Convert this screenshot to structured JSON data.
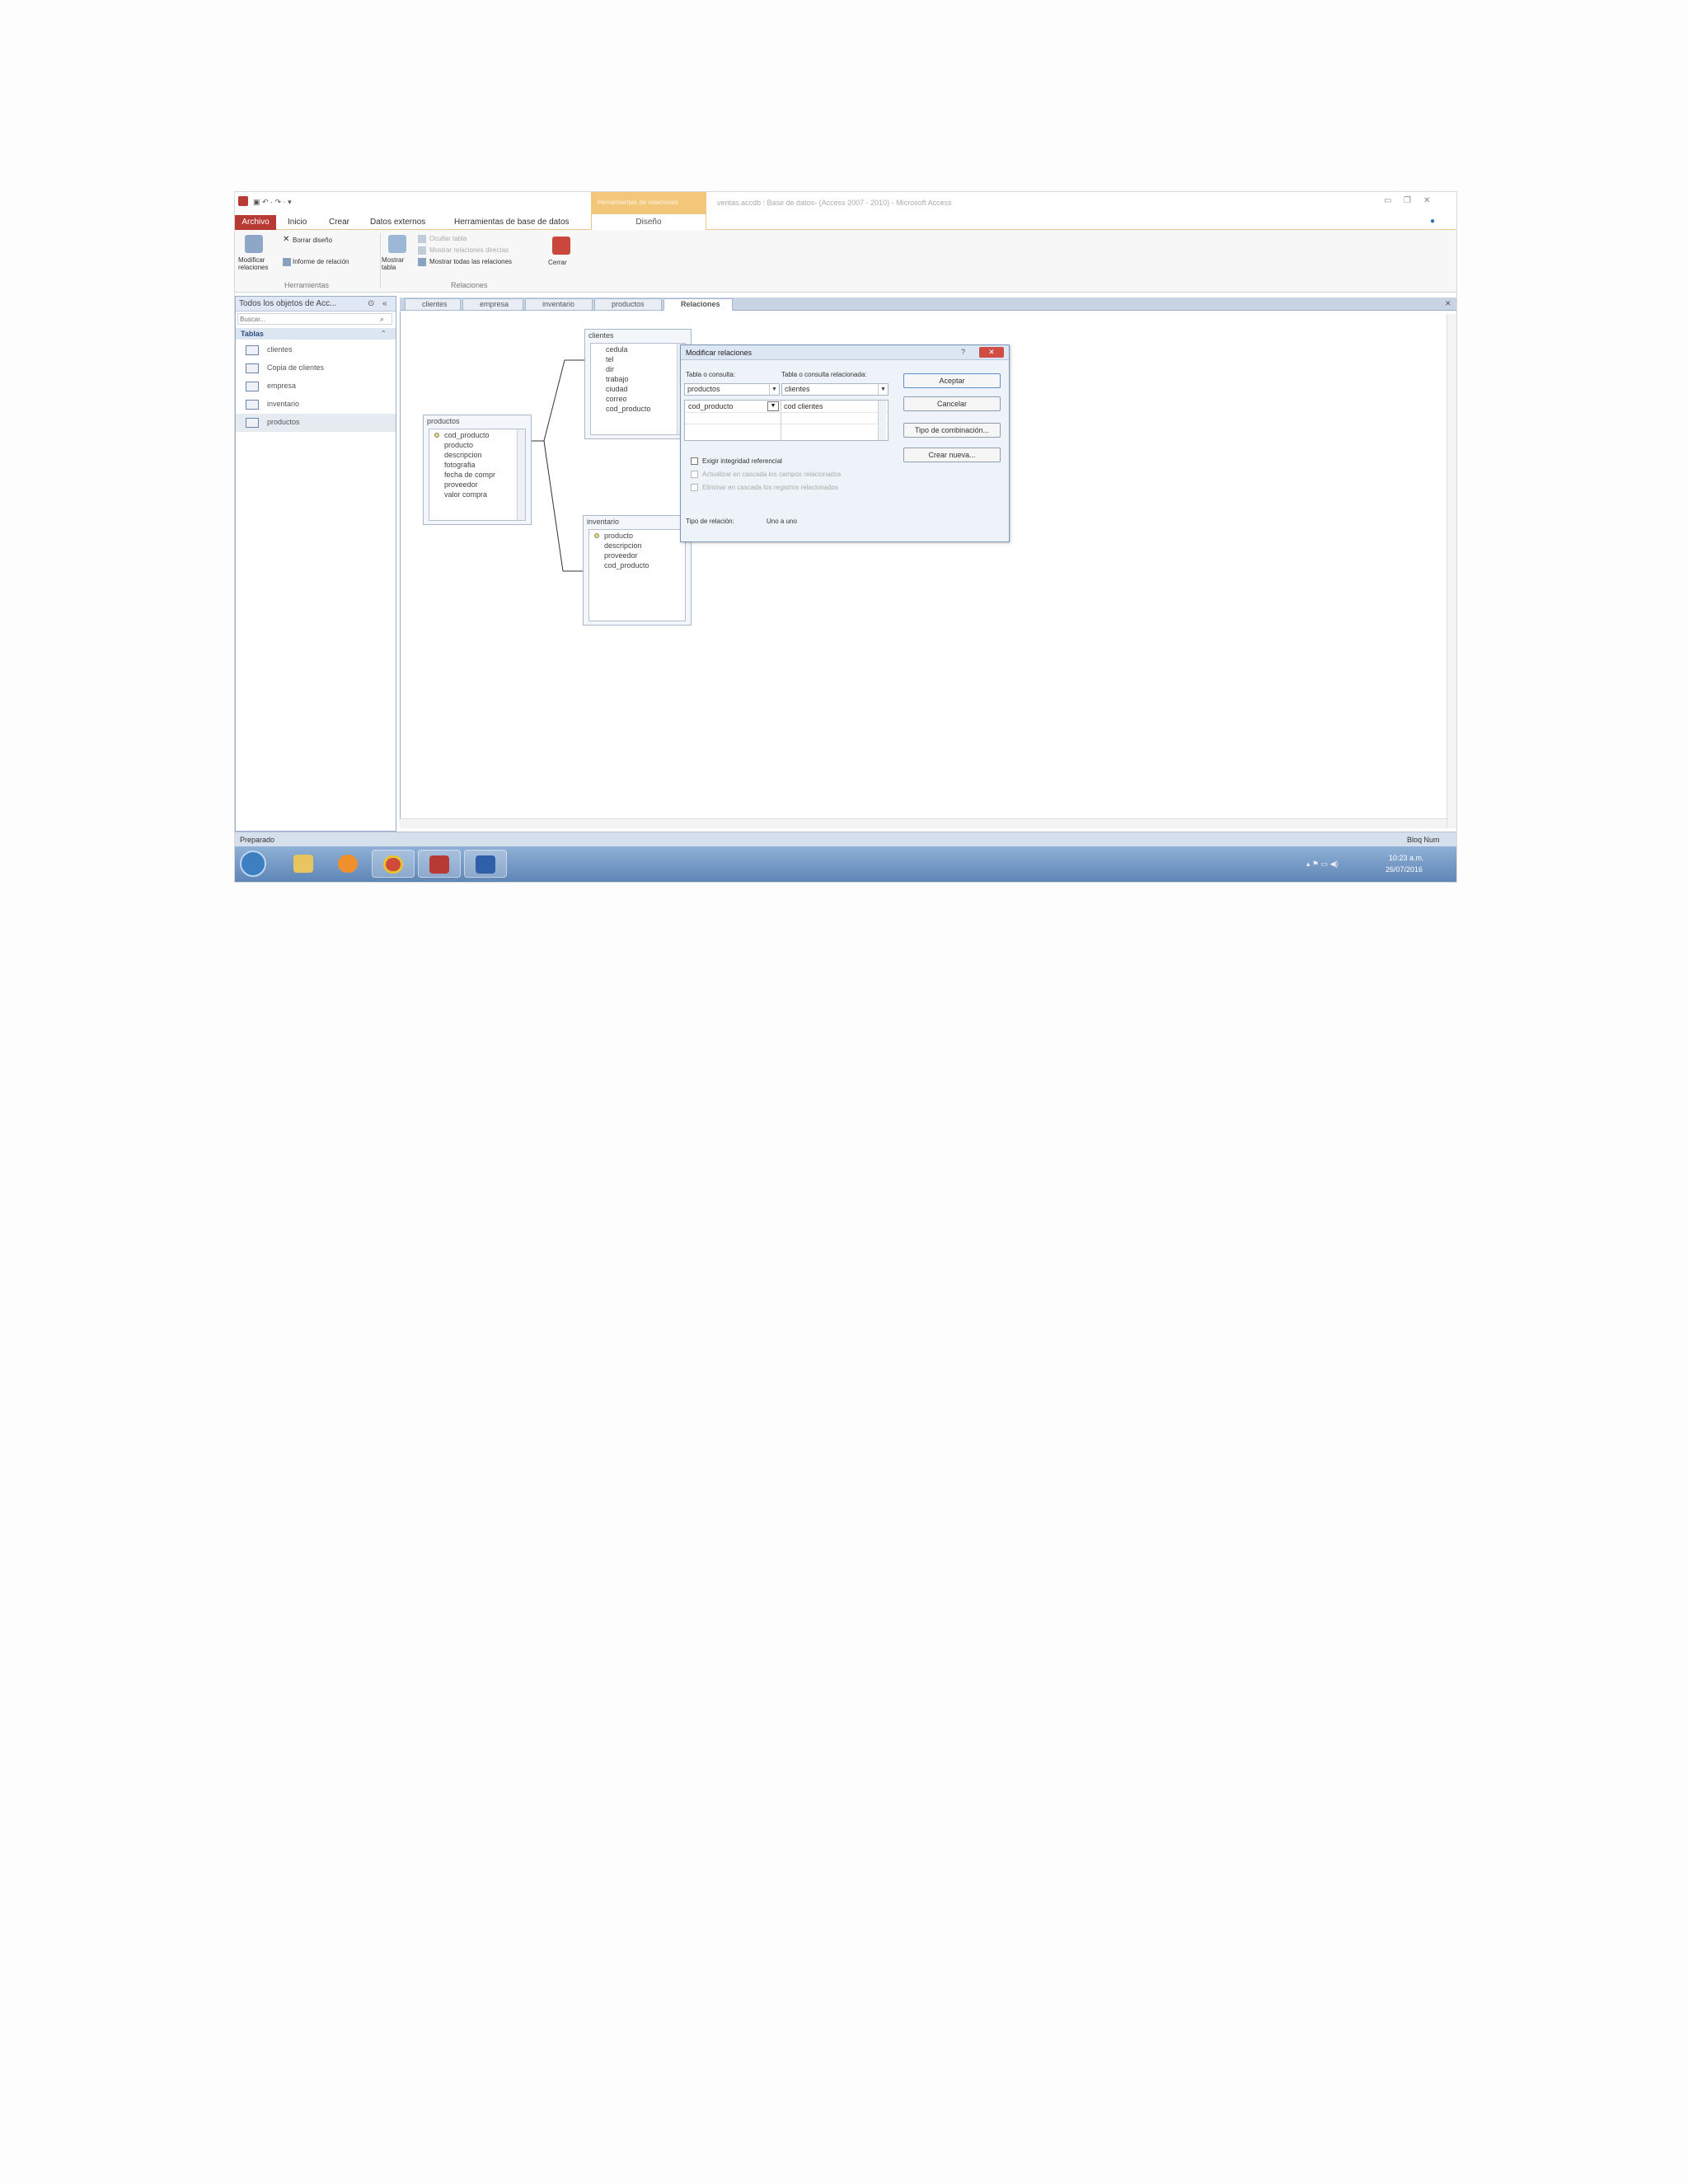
{
  "window": {
    "title": "ventas.accdb : Base de datos- (Access 2007 - 2010) - Microsoft Access",
    "context_tab": "Herramientas de relaciones",
    "quick_access": "▣ ↶ · ↷ · ▾"
  },
  "ribbon": {
    "tabs": [
      "Archivo",
      "Inicio",
      "Crear",
      "Datos externos",
      "Herramientas de base de datos",
      "Diseño"
    ],
    "buttons": {
      "edit_relationships": "Modificar relaciones",
      "clear_layout": "Borrar diseño",
      "relationship_report": "Informe de relación",
      "show_table": "Mostrar tabla",
      "hide_table": "Ocultar tabla",
      "direct_relationships": "Mostrar relaciones directas",
      "all_relationships": "Mostrar todas las relaciones",
      "close": "Cerrar"
    },
    "groups": [
      "Herramientas",
      "Relaciones"
    ]
  },
  "nav_pane": {
    "header": "Todos los objetos de Acc...",
    "search_placeholder": "Buscar...",
    "section": "Tablas",
    "items": [
      "clientes",
      "Copia de clientes",
      "empresa",
      "inventario",
      "productos"
    ],
    "selected_index": 4
  },
  "document_tabs": [
    "clientes",
    "empresa",
    "inventario",
    "productos",
    "Relaciones"
  ],
  "relationship_tables": {
    "clientes": {
      "title": "clientes",
      "fields": [
        "cedula",
        "tel",
        "dir",
        "trabajo",
        "ciudad",
        "correo",
        "cod_producto"
      ]
    },
    "productos": {
      "title": "productos",
      "fields": [
        "cod_producto",
        "producto",
        "descripcion",
        "fotografia",
        "fecha de compr",
        "proveedor",
        "valor compra"
      ]
    },
    "inventario": {
      "title": "inventario",
      "fields": [
        "producto",
        "descripcion",
        "proveedor",
        "cod_producto"
      ]
    }
  },
  "dialog": {
    "title": "Modificar relaciones",
    "table_label": "Tabla o consulta:",
    "related_label": "Tabla o consulta relacionada:",
    "table_value": "productos",
    "related_value": "clientes",
    "field_left": "cod_producto",
    "field_right": "cod clientes",
    "enforce_integrity": "Exigir integridad referencial",
    "cascade_update": "Actualizar en cascada los campos relacionados",
    "cascade_delete": "Eliminar en cascada los registros relacionados",
    "relationship_type_label": "Tipo de relación:",
    "relationship_type_value": "Uno a uno",
    "buttons": [
      "Aceptar",
      "Cancelar",
      "Tipo de combinación...",
      "Crear nueva..."
    ]
  },
  "status": {
    "left": "Preparado",
    "right": "Bloq Num"
  },
  "taskbar": {
    "time": "10:23 a.m.",
    "date": "26/07/2016",
    "tray": "▴ ⚑ ▭ ◀)"
  }
}
